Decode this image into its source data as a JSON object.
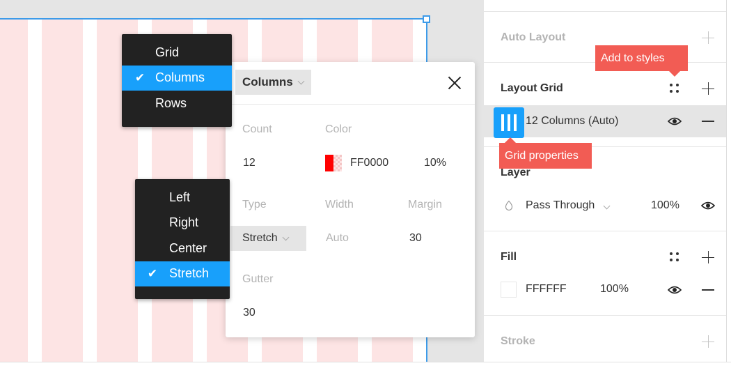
{
  "canvas": {
    "frame": {
      "column_color": "#FDE4E4",
      "selection_color": "#3D9BE9"
    }
  },
  "grid_type_menu": {
    "items": [
      {
        "label": "Grid",
        "selected": false
      },
      {
        "label": "Columns",
        "selected": true
      },
      {
        "label": "Rows",
        "selected": false
      }
    ],
    "check_glyph": "✔"
  },
  "alignment_menu": {
    "items": [
      {
        "label": "Left",
        "selected": false
      },
      {
        "label": "Right",
        "selected": false
      },
      {
        "label": "Center",
        "selected": false
      },
      {
        "label": "Stretch",
        "selected": true
      }
    ],
    "check_glyph": "✔"
  },
  "grid_popup": {
    "type_select": "Columns",
    "close_icon": "close-icon",
    "count": {
      "label": "Count",
      "value": "12"
    },
    "color": {
      "label": "Color",
      "hex": "FF0000",
      "opacity": "10%",
      "swatch": "#FF0000"
    },
    "type": {
      "label": "Type",
      "value": "Stretch"
    },
    "width": {
      "label": "Width",
      "value": "Auto"
    },
    "margin": {
      "label": "Margin",
      "value": "30"
    },
    "gutter": {
      "label": "Gutter",
      "value": "30"
    }
  },
  "panel": {
    "auto_layout": {
      "title": "Auto Layout",
      "add_icon": "plus-icon"
    },
    "layout_grid": {
      "title": "Layout Grid",
      "styles_icon": "style-dots-icon",
      "add_icon": "plus-icon",
      "grid_item": {
        "label": "12 Columns (Auto)",
        "icon": "columns-grid-icon",
        "visibility_icon": "eye-icon",
        "remove_icon": "minus-icon"
      }
    },
    "layer": {
      "title": "Layer",
      "blend_mode": "Pass Through",
      "opacity": "100%",
      "visibility_icon": "eye-icon"
    },
    "fill": {
      "title": "Fill",
      "hex": "FFFFFF",
      "opacity": "100%",
      "swatch": "#FFFFFF"
    },
    "stroke": {
      "title": "Stroke",
      "add_icon": "plus-icon"
    }
  },
  "tooltips": {
    "add_to_styles": "Add to styles",
    "grid_properties": "Grid properties",
    "color": "#F25C54"
  },
  "colors": {
    "accent": "#18A0FB",
    "menu_bg": "#222222"
  }
}
